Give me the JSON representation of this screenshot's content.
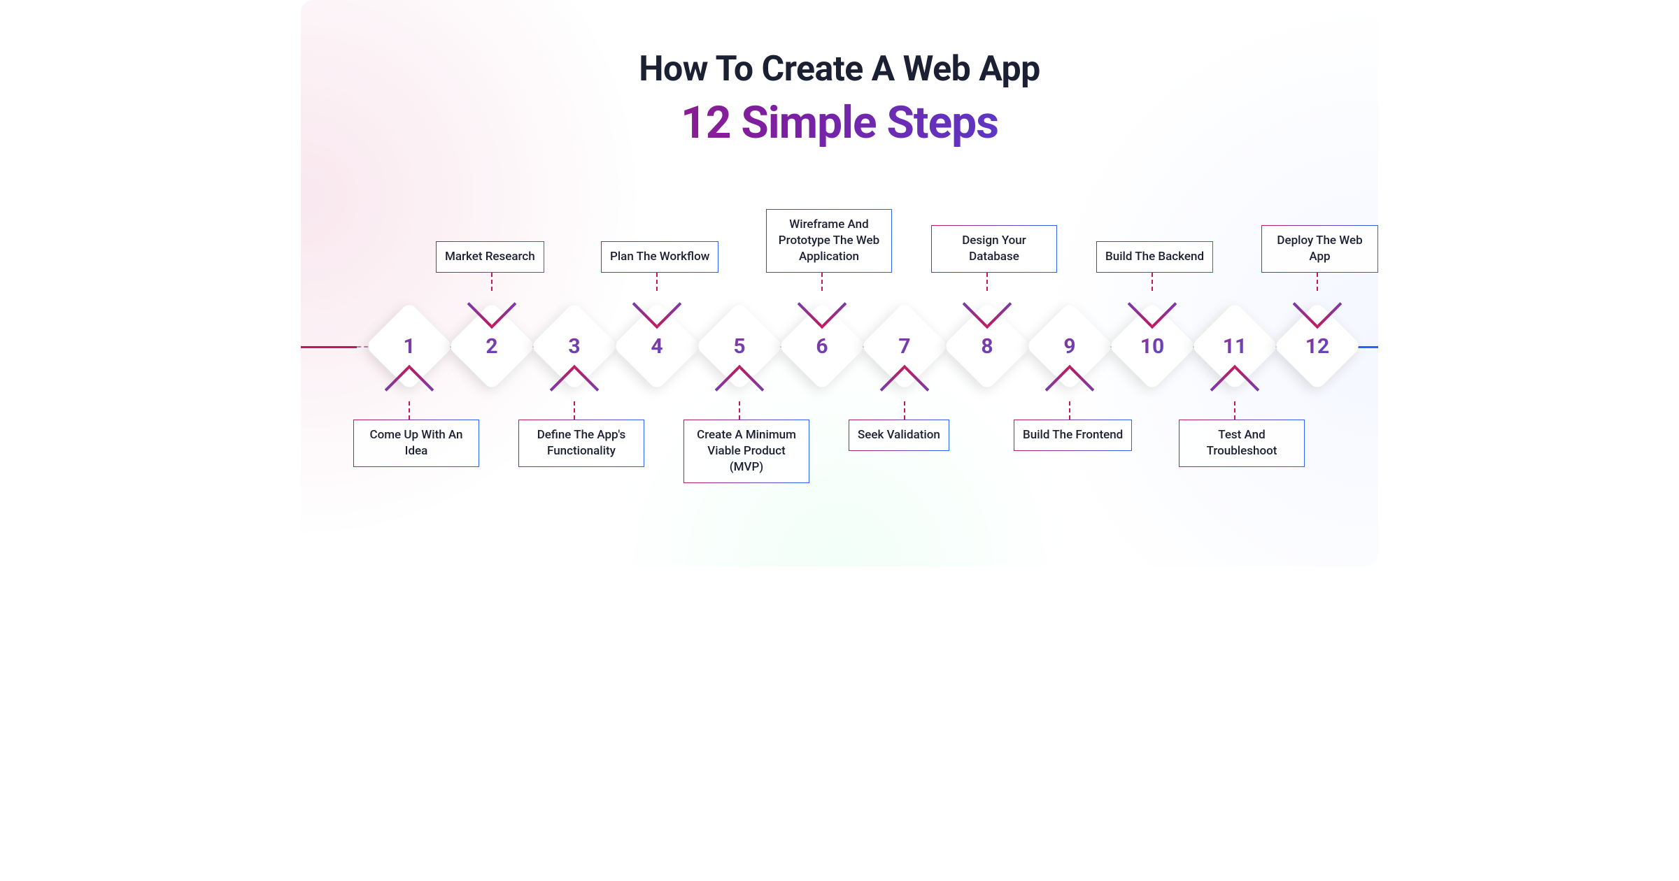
{
  "title": {
    "line1": "How To Create A Web App",
    "line2": "12 Simple Steps"
  },
  "steps": [
    {
      "n": "1",
      "side": "below",
      "label": "Come Up With An Idea"
    },
    {
      "n": "2",
      "side": "above",
      "label": "Market Research"
    },
    {
      "n": "3",
      "side": "below",
      "label": "Define The App's Functionality"
    },
    {
      "n": "4",
      "side": "above",
      "label": "Plan The Workflow"
    },
    {
      "n": "5",
      "side": "below",
      "label": "Create A Minimum Viable Product (MVP)"
    },
    {
      "n": "6",
      "side": "above",
      "label": "Wireframe And Prototype The Web Application"
    },
    {
      "n": "7",
      "side": "below",
      "label": "Seek Validation"
    },
    {
      "n": "8",
      "side": "above",
      "label": "Design Your Database"
    },
    {
      "n": "9",
      "side": "below",
      "label": "Build The Frontend"
    },
    {
      "n": "10",
      "side": "above",
      "label": "Build The Backend"
    },
    {
      "n": "11",
      "side": "below",
      "label": "Test And Troubleshoot"
    },
    {
      "n": "12",
      "side": "above",
      "label": "Deploy The Web App"
    }
  ],
  "colors": {
    "gradient_start": "#C2185B",
    "gradient_end": "#2962FF",
    "dark": "#1B2033"
  }
}
